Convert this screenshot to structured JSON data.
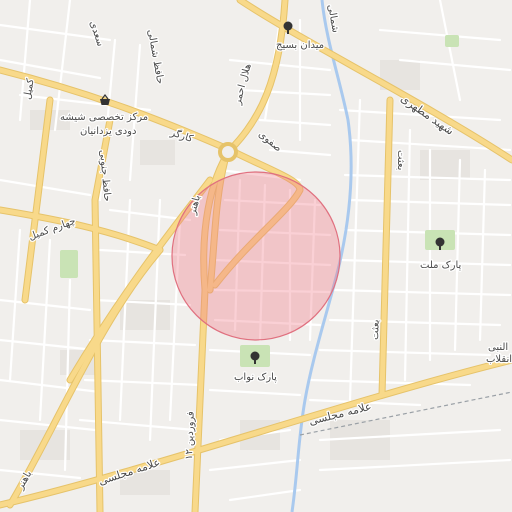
{
  "map": {
    "colors": {
      "background": "#f1efec",
      "minor_road": "#ffffff",
      "major_road": "#f8d98a",
      "major_road_casing": "#e6c36a",
      "river": "#a9c9ee",
      "park": "#c9e3b5",
      "radius_fill": "rgba(240,120,135,0.35)",
      "radius_stroke": "#e0707f"
    },
    "pois": [
      {
        "id": "maidan-basij",
        "label": "میدان بسیج",
        "icon": "tree-icon"
      },
      {
        "id": "glass-center",
        "label": "مرکز تخصصی شیشه",
        "label2": "دودی یزدانیان",
        "icon": "shopping-basket-icon"
      },
      {
        "id": "park-mellat",
        "label": "پارک ملت",
        "icon": "tree-icon"
      },
      {
        "id": "park-navab",
        "label": "پارک نواب",
        "icon": "tree-icon"
      }
    ],
    "streets": {
      "saadi": "سعدی",
      "hafez_north": "حافظ شمالی",
      "hafez_south": "حافظ جنوبی",
      "kargar": "کارگر",
      "bahonar": "باهنر",
      "safavi": "صفوی",
      "hellal_ahmar": "هلال احمر",
      "kamil": "کمیل",
      "chaharom_kamil": "چهارم کمیل",
      "motahari": "شهید مطهری",
      "besat": "بعثت",
      "allameh_majlesi_1": "علامه مجلسی",
      "allameh_majlesi_2": "علامه مجلسی",
      "farvardin": "۱۲ فروردین",
      "bahonar_south": "باهنر",
      "shomali": "شمالی",
      "nabi": "النبی",
      "enghelab": "انقلاب"
    }
  }
}
